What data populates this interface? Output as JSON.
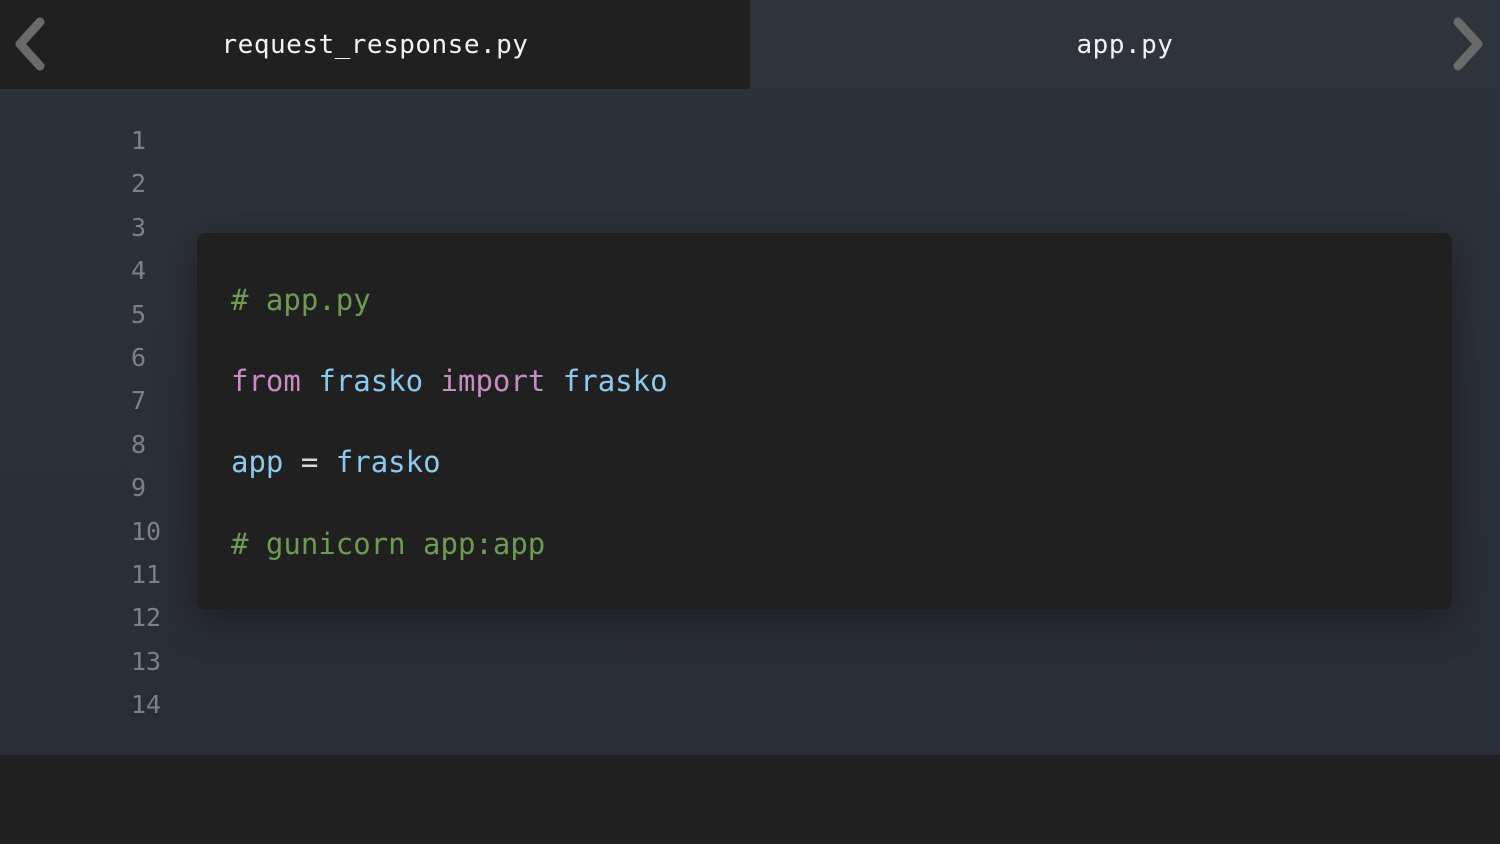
{
  "tabs": [
    {
      "label": "request_response.py",
      "active": true
    },
    {
      "label": "app.py",
      "active": false
    }
  ],
  "navigation": {
    "prev_icon": "chevron-left-icon",
    "next_icon": "chevron-right-icon"
  },
  "line_numbers": [
    "1",
    "2",
    "3",
    "4",
    "5",
    "6",
    "7",
    "8",
    "9",
    "10",
    "11",
    "12",
    "13",
    "14"
  ],
  "code": {
    "line1": {
      "comment": "# app.py"
    },
    "line2": {
      "kw_from": "from",
      "module": "frasko",
      "kw_import": "import",
      "name": "frasko"
    },
    "line3": {
      "var": "app",
      "op": "=",
      "value": "frasko"
    },
    "line4": {
      "comment": "# gunicorn app:app"
    }
  },
  "colors": {
    "comment": "#6e9a54",
    "keyword": "#c98dc6",
    "identifier": "#8cc9ee",
    "editor_bg": "#2e323a",
    "card_bg": "#202020"
  }
}
